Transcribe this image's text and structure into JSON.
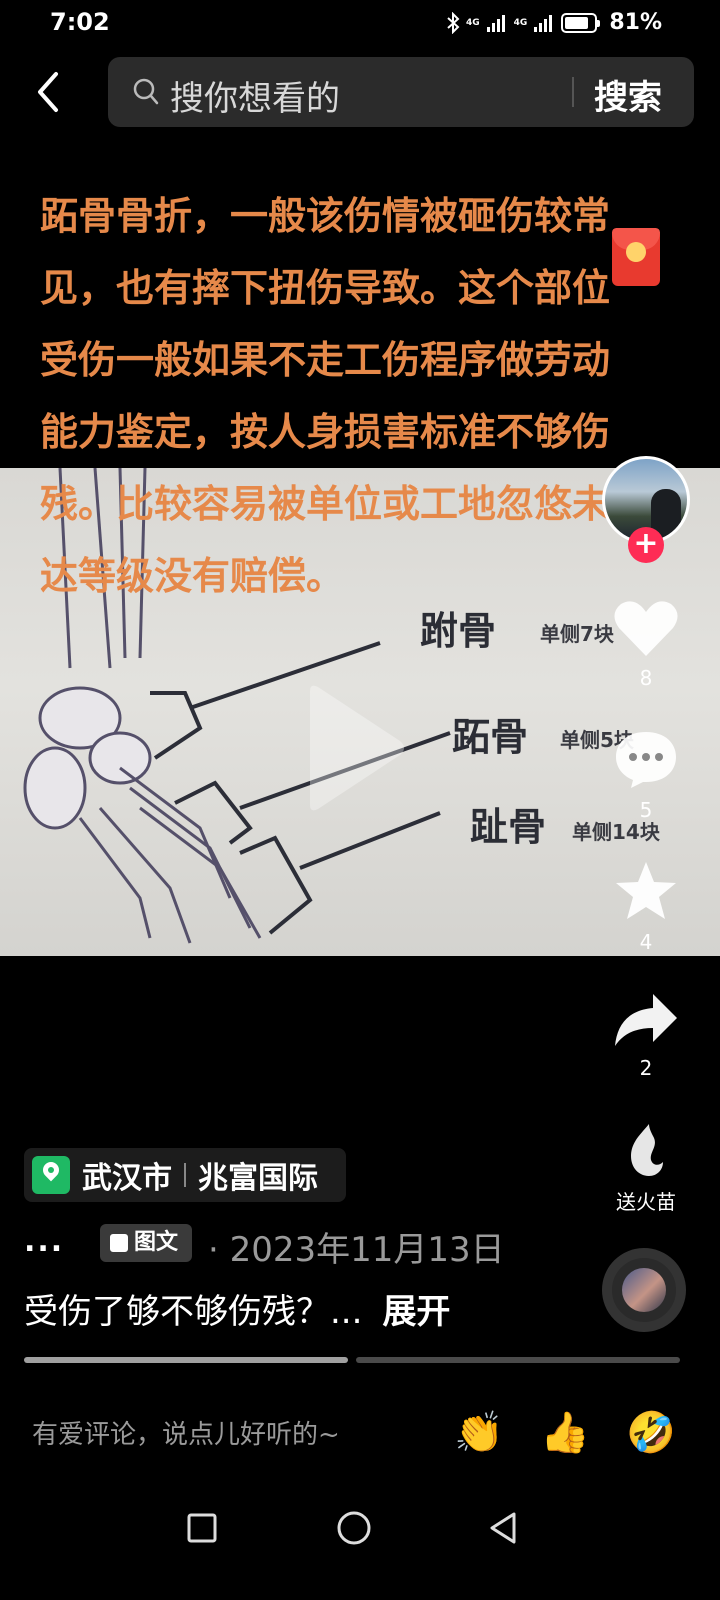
{
  "status_bar": {
    "time": "7:02",
    "network_1": "4G",
    "network_2": "4G",
    "battery_percent_text": "81%",
    "battery_level": 0.81
  },
  "search": {
    "placeholder": "搜你想看的",
    "button_label": "搜索"
  },
  "overlay_text": "跖骨骨折，一般该伤情被砸伤较常见，也有摔下扭伤导致。这个部位受伤一般如果不走工伤程序做劳动能力鉴定，按人身损害标准不够伤残。比较容易被单位或工地忽悠未达等级没有赔偿。",
  "media_labels": {
    "tarsal": "跗骨",
    "tarsal_note": "单侧7块",
    "metatarsal": "跖骨",
    "metatarsal_note": "单侧5块",
    "phalanx": "趾骨",
    "phalanx_note": "单侧14块"
  },
  "actions": {
    "like_count": "8",
    "comment_count": "5",
    "favorite_count": "4",
    "share_count": "2",
    "gift_label": "送火苗"
  },
  "location": {
    "city": "武汉市",
    "place": "兆富国际"
  },
  "meta": {
    "dots": "...",
    "type_badge": "图文",
    "date": "· 2023年11月13日"
  },
  "caption": {
    "text": "受伤了够不够伤残？...",
    "expand_label": "展开"
  },
  "progress": {
    "segments": 2,
    "current_segment": 1
  },
  "comment": {
    "placeholder": "有爱评论，说点儿好听的~",
    "emojis": [
      "👏",
      "👍",
      "🤣"
    ]
  },
  "colors": {
    "overlay_text": "#e6894a",
    "follow": "#fe2c55",
    "location_pin": "#1fb964"
  },
  "icons": [
    "back-arrow-icon",
    "search-icon",
    "red-envelope-icon",
    "heart-icon",
    "comment-icon",
    "star-icon",
    "share-icon",
    "flame-icon",
    "play-icon",
    "square-nav-icon",
    "circle-nav-icon",
    "triangle-back-nav-icon"
  ]
}
